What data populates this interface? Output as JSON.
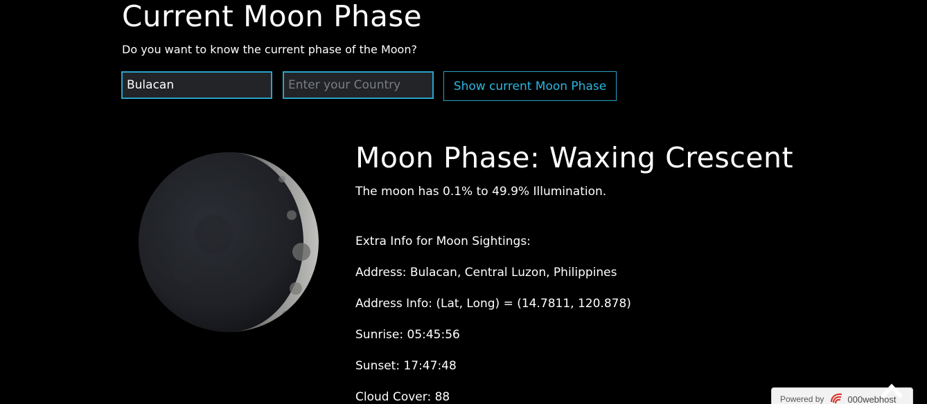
{
  "header": {
    "title": "Current Moon Phase",
    "subtitle": "Do you want to know the current phase of the Moon?"
  },
  "form": {
    "city_value": "Bulacan",
    "country_value": "",
    "country_placeholder": "Enter your Country",
    "submit_label": "Show current Moon Phase"
  },
  "result": {
    "phase_title": "Moon Phase: Waxing Crescent",
    "illumination": "The moon has 0.1% to 49.9% Illumination.",
    "extra_heading": "Extra Info for Moon Sightings:",
    "address": "Address: Bulacan, Central Luzon, Philippines",
    "address_info": "Address Info: (Lat, Long) = (14.7811, 120.878)",
    "sunrise": "Sunrise: 05:45:56",
    "sunset": "Sunset: 17:47:48",
    "cloud_cover": "Cloud Cover: 88"
  },
  "footer": {
    "powered_by": "Powered by",
    "brand": "000webhost"
  },
  "icons": {
    "moon": "moon-crescent-image",
    "scroll_top": "chevron-up-icon",
    "host_logo": "webhost-logo-icon"
  },
  "colors": {
    "background": "#000000",
    "accent": "#2aa4c9",
    "button_text": "#2eb6e0",
    "input_bg": "#222428"
  }
}
